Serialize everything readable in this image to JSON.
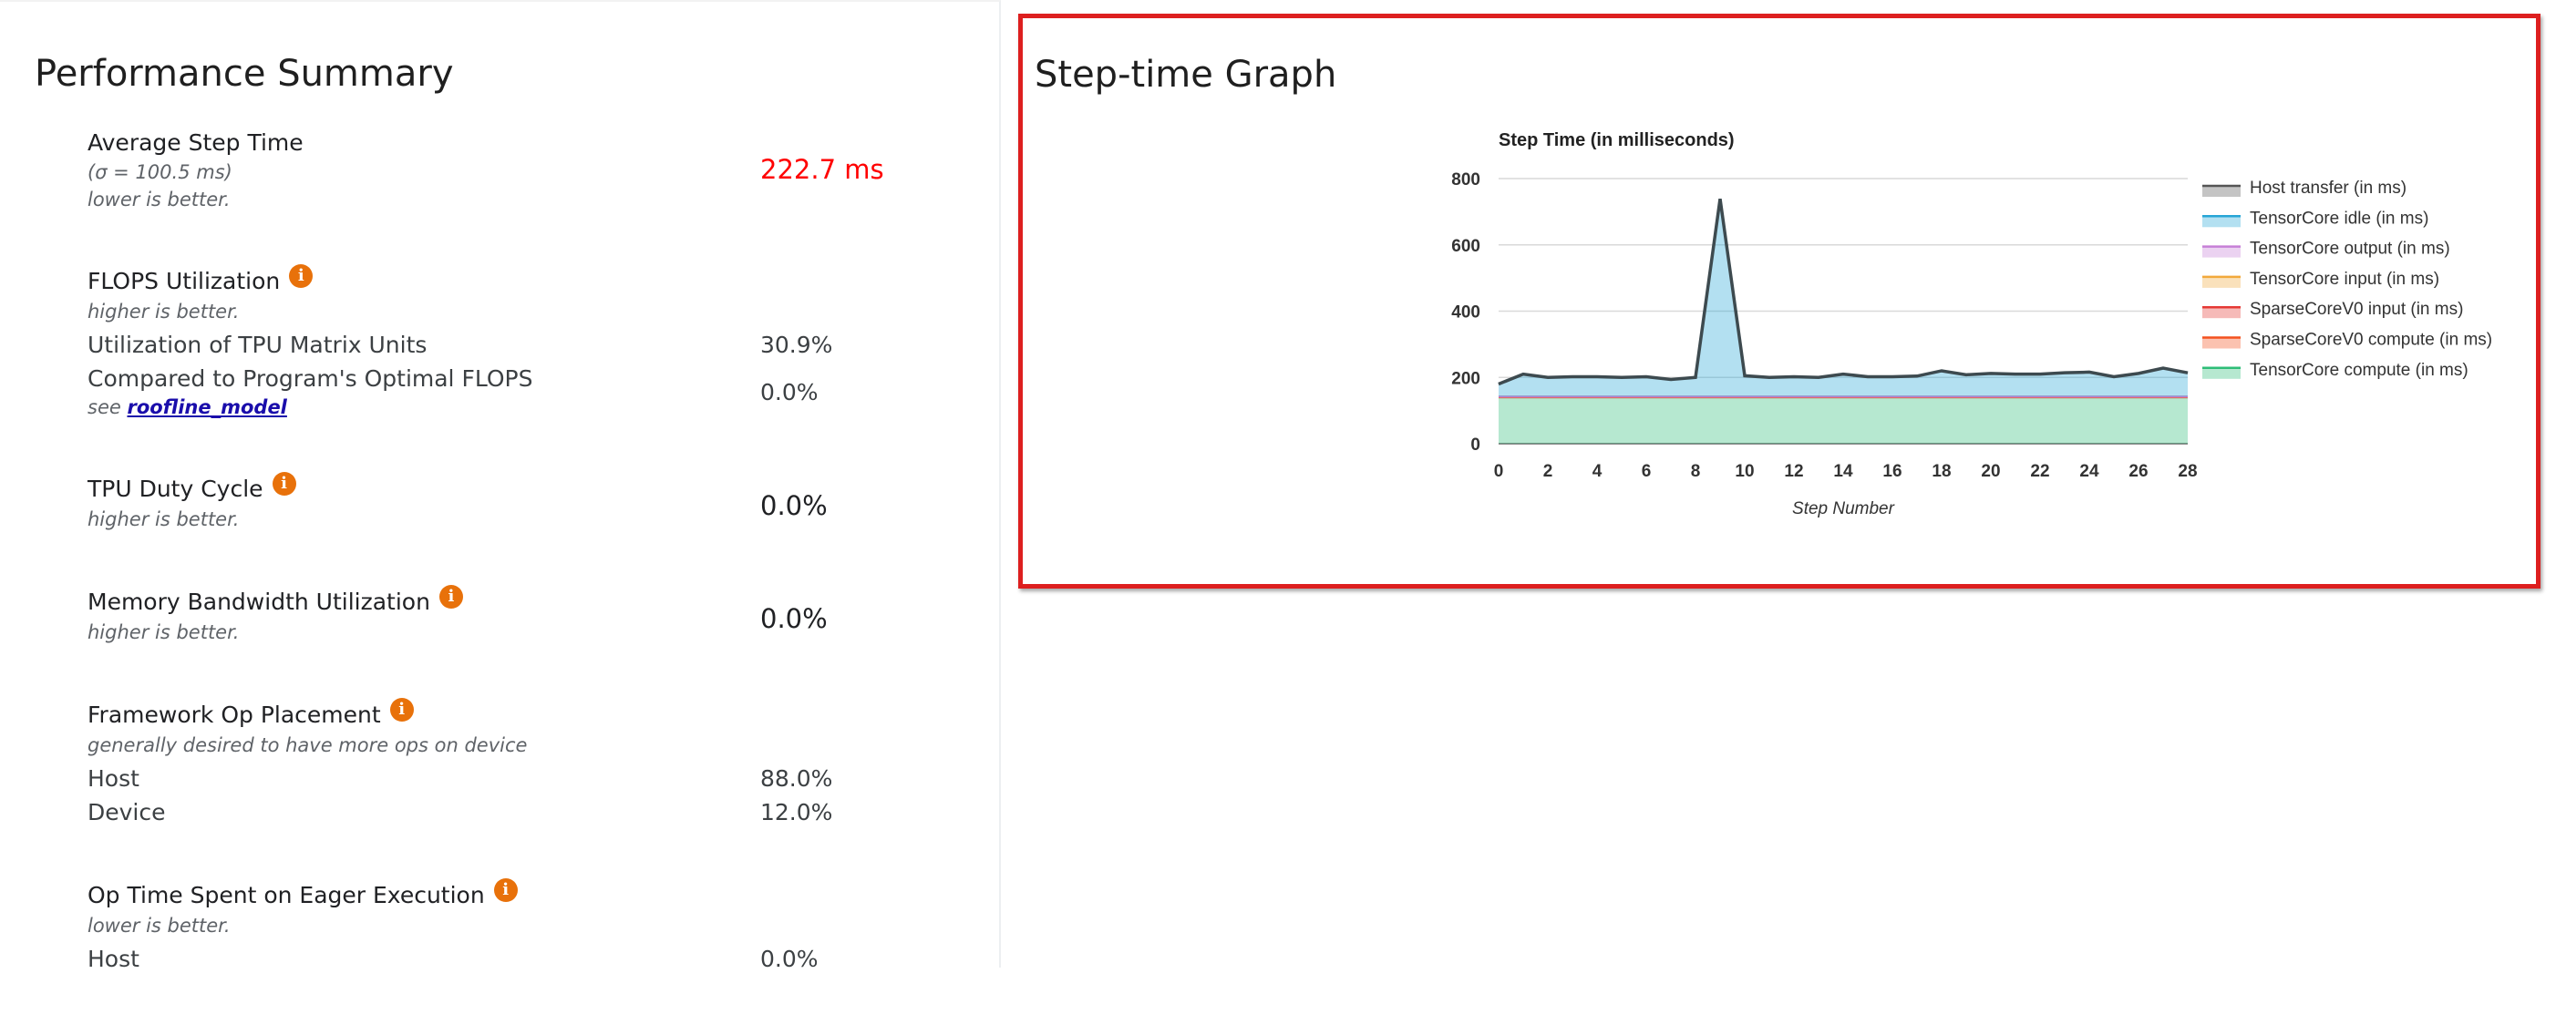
{
  "performance_summary": {
    "title": "Performance Summary",
    "average_step_time": {
      "title": "Average Step Time",
      "sigma": "(σ = 100.5 ms)",
      "hint": "lower is better.",
      "value": "222.7 ms",
      "value_color": "#ff0000"
    },
    "flops_utilization": {
      "title": "FLOPS Utilization",
      "hint": "higher is better.",
      "rows": [
        {
          "label": "Utilization of TPU Matrix Units",
          "value": "30.9%"
        },
        {
          "label": "Compared to Program's Optimal FLOPS",
          "value": "0.0%"
        }
      ],
      "see_prefix": "see",
      "see_link": "roofline_model"
    },
    "tpu_duty_cycle": {
      "title": "TPU Duty Cycle",
      "hint": "higher is better.",
      "value": "0.0%"
    },
    "memory_bandwidth": {
      "title": "Memory Bandwidth Utilization",
      "hint": "higher is better.",
      "value": "0.0%"
    },
    "framework_op_placement": {
      "title": "Framework Op Placement",
      "hint": "generally desired to have more ops on device",
      "rows": [
        {
          "label": "Host",
          "value": "88.0%"
        },
        {
          "label": "Device",
          "value": "12.0%"
        }
      ]
    },
    "eager_execution": {
      "title": "Op Time Spent on Eager Execution",
      "hint": "lower is better.",
      "rows": [
        {
          "label": "Host",
          "value": "0.0%"
        }
      ]
    },
    "info_icon": "info-icon",
    "accent_color": "#e8710a"
  },
  "step_time_graph": {
    "title": "Step-time Graph",
    "border_color": "#dd1f1f"
  },
  "chart_data": {
    "type": "area",
    "title": "Step Time (in milliseconds)",
    "xlabel": "Step Number",
    "ylabel": "",
    "xlim": [
      0,
      28
    ],
    "ylim": [
      0,
      800
    ],
    "x_ticks": [
      0,
      2,
      4,
      6,
      8,
      10,
      12,
      14,
      16,
      18,
      20,
      22,
      24,
      26,
      28
    ],
    "y_ticks": [
      0,
      200,
      400,
      600,
      800
    ],
    "grid": true,
    "legend_position": "right",
    "stacked": true,
    "x": [
      0,
      1,
      2,
      3,
      4,
      5,
      6,
      7,
      8,
      9,
      10,
      11,
      12,
      13,
      14,
      15,
      16,
      17,
      18,
      19,
      20,
      21,
      22,
      23,
      24,
      25,
      26,
      27,
      28
    ],
    "series": [
      {
        "name": "TensorCore compute (in ms)",
        "color": "#2ebd77",
        "values": [
          140,
          140,
          140,
          140,
          140,
          140,
          140,
          140,
          140,
          140,
          140,
          140,
          140,
          140,
          140,
          140,
          140,
          140,
          140,
          140,
          140,
          140,
          140,
          140,
          140,
          140,
          140,
          140,
          140
        ]
      },
      {
        "name": "SparseCoreV0 compute (in ms)",
        "color": "#f4511e",
        "values": [
          0,
          0,
          0,
          0,
          0,
          0,
          0,
          0,
          0,
          0,
          0,
          0,
          0,
          0,
          0,
          0,
          0,
          0,
          0,
          0,
          0,
          0,
          0,
          0,
          0,
          0,
          0,
          0,
          0
        ]
      },
      {
        "name": "SparseCoreV0 input (in ms)",
        "color": "#e53935",
        "values": [
          2,
          2,
          2,
          2,
          2,
          2,
          2,
          2,
          2,
          2,
          2,
          2,
          2,
          2,
          2,
          2,
          2,
          2,
          2,
          2,
          2,
          2,
          2,
          2,
          2,
          2,
          2,
          2,
          2
        ]
      },
      {
        "name": "TensorCore input (in ms)",
        "color": "#f2a93b",
        "values": [
          0,
          0,
          0,
          0,
          0,
          0,
          0,
          0,
          0,
          0,
          0,
          0,
          0,
          0,
          0,
          0,
          0,
          0,
          0,
          0,
          0,
          0,
          0,
          0,
          0,
          0,
          0,
          0,
          0
        ]
      },
      {
        "name": "TensorCore output (in ms)",
        "color": "#c67fd6",
        "values": [
          0,
          0,
          0,
          0,
          0,
          0,
          0,
          0,
          0,
          0,
          0,
          0,
          0,
          0,
          0,
          0,
          0,
          0,
          0,
          0,
          0,
          0,
          0,
          0,
          0,
          0,
          0,
          0,
          0
        ]
      },
      {
        "name": "TensorCore idle (in ms)",
        "color": "#26a5d6",
        "values": [
          38,
          68,
          58,
          60,
          60,
          58,
          60,
          52,
          58,
          597,
          63,
          58,
          60,
          58,
          68,
          60,
          60,
          62,
          78,
          66,
          70,
          68,
          68,
          72,
          74,
          60,
          70,
          86,
          72
        ]
      },
      {
        "name": "Host transfer (in ms)",
        "color": "#555555",
        "values": [
          0,
          0,
          0,
          0,
          0,
          0,
          0,
          0,
          0,
          0,
          0,
          0,
          0,
          0,
          0,
          0,
          0,
          0,
          0,
          0,
          0,
          0,
          0,
          0,
          0,
          0,
          0,
          0,
          0
        ]
      }
    ]
  }
}
